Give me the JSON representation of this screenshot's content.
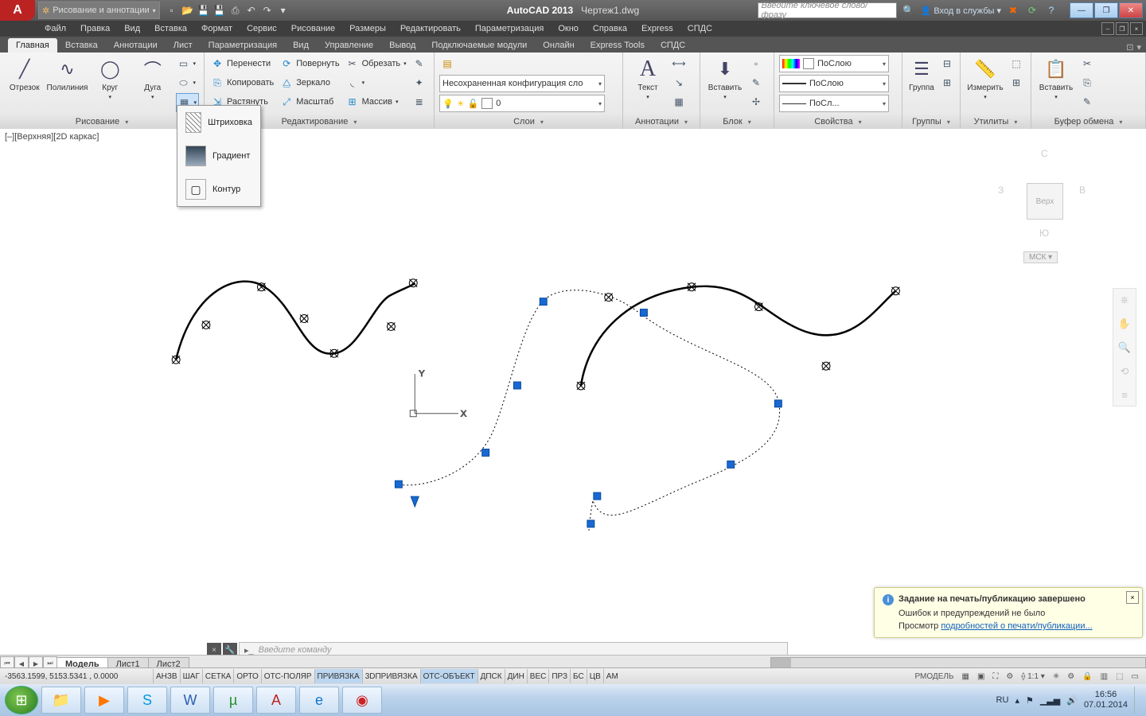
{
  "title": {
    "app": "AutoCAD 2013",
    "file": "Чертеж1.dwg",
    "workspace": "Рисование и аннотации",
    "search_ph": "Введите ключевое слово/фразу",
    "signin": "Вход в службы"
  },
  "menus": [
    "Файл",
    "Правка",
    "Вид",
    "Вставка",
    "Формат",
    "Сервис",
    "Рисование",
    "Размеры",
    "Редактировать",
    "Параметризация",
    "Окно",
    "Справка",
    "Express",
    "СПДС"
  ],
  "tabs": [
    "Главная",
    "Вставка",
    "Аннотации",
    "Лист",
    "Параметризация",
    "Вид",
    "Управление",
    "Вывод",
    "Подключаемые модули",
    "Онлайн",
    "Express Tools",
    "СПДС"
  ],
  "ribbon": {
    "draw": {
      "title": "Рисование",
      "line": "Отрезок",
      "pline": "Полилиния",
      "circle": "Круг",
      "arc": "Дуга"
    },
    "modify": {
      "title": "Редактирование",
      "move": "Перенести",
      "rotate": "Повернуть",
      "trim": "Обрезать",
      "copy": "Копировать",
      "mirror": "Зеркало",
      "stretch": "Растянуть",
      "scale": "Масштаб",
      "array": "Массив"
    },
    "layers": {
      "title": "Слои",
      "unsaved": "Несохраненная конфигурация сло",
      "cur": "0"
    },
    "annot": {
      "title": "Аннотации",
      "text": "Текст"
    },
    "block": {
      "title": "Блок",
      "insert": "Вставить"
    },
    "props": {
      "title": "Свойства",
      "bylayer": "ПоСлою",
      "bylayer2": "ПоСлою",
      "bylayer3": "ПоСл..."
    },
    "groups": {
      "title": "Группы",
      "group": "Группа"
    },
    "utils": {
      "title": "Утилиты",
      "measure": "Измерить"
    },
    "clip": {
      "title": "Буфер обмена",
      "paste": "Вставить"
    }
  },
  "flyout": {
    "hatch": "Штриховка",
    "grad": "Градиент",
    "bound": "Контур"
  },
  "viewport": {
    "label": "[–][Верхняя][2D каркас]"
  },
  "viewcube": {
    "top": "С",
    "left": "З",
    "right": "В",
    "bottom": "Ю",
    "face": "Верх",
    "wcs": "МСК"
  },
  "cmd": {
    "placeholder": "Введите команду"
  },
  "sheets": {
    "model": "Модель",
    "s1": "Лист1",
    "s2": "Лист2"
  },
  "status": {
    "coords": "-3563.1599, 5153.5341 , 0.0000",
    "toggles": [
      "АНЗВ",
      "ШАГ",
      "СЕТКА",
      "ОРТО",
      "ОТС-ПОЛЯР",
      "ПРИВЯЗКА",
      "3DПРИВЯЗКА",
      "ОТС-ОБЪЕКТ",
      "ДПСК",
      "ДИН",
      "ВЕС",
      "ПРЗ",
      "БС",
      "ЦВ",
      "АМ"
    ],
    "toggles_on": [
      5,
      7
    ],
    "right": {
      "space": "РМОДЕЛЬ",
      "scale": "1:1"
    }
  },
  "notif": {
    "title": "Задание на печать/публикацию завершено",
    "body": "Ошибок и предупреждений не было",
    "link_pre": "Просмотр",
    "link": "подробностей о печати/публикации..."
  },
  "tray": {
    "lang": "RU",
    "time": "16:56",
    "date": "07.01.2014"
  }
}
